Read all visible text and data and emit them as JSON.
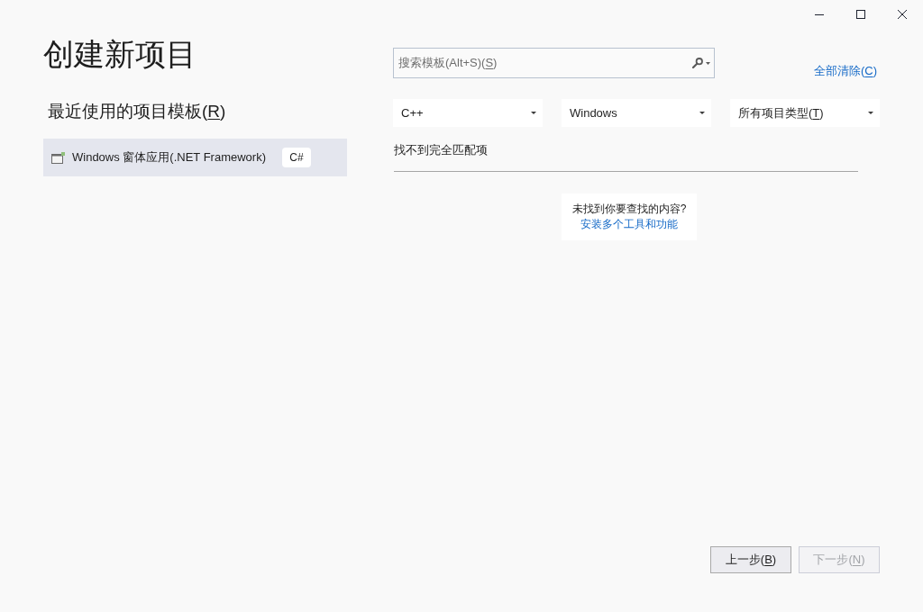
{
  "title": "创建新项目",
  "recent": {
    "heading": {
      "label": "最近使用的项目模板(R)",
      "access_key_underlined": true
    },
    "items": [
      {
        "name": "Windows 窗体应用(.NET Framework)",
        "language": "C#",
        "selected": true
      }
    ]
  },
  "search": {
    "placeholder": "搜索模板(Alt+S)(S)",
    "access_key_underlined": true
  },
  "clear_all": {
    "label": "全部清除(C)",
    "access_key_underlined": true
  },
  "filters": [
    {
      "value": "C++"
    },
    {
      "value": "Windows"
    },
    {
      "value": "所有项目类型(T)",
      "access_key_underlined": true
    }
  ],
  "results": {
    "message": "找不到完全匹配项"
  },
  "help": {
    "question": "未找到你要查找的内容?",
    "link": "安装多个工具和功能"
  },
  "buttons": [
    {
      "label": "上一步(B)",
      "access_key_underlined": true,
      "disabled": false
    },
    {
      "label": "下一步(N)",
      "access_key_underlined": true,
      "disabled": true
    }
  ]
}
